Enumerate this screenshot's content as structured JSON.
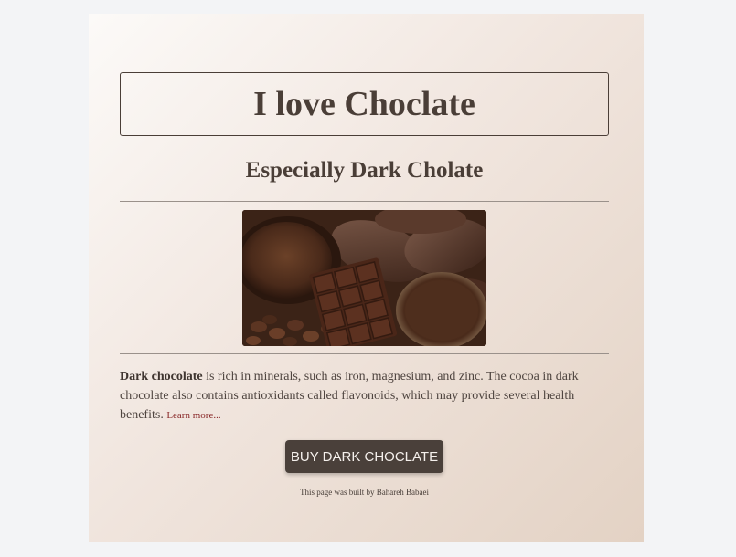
{
  "header": {
    "title": "I love Choclate",
    "subtitle": "Especially Dark Cholate"
  },
  "hero_image": {
    "alt": "dark chocolate bar with cocoa beans and cocoa powder"
  },
  "content": {
    "bold_lead": "Dark chocolate",
    "text": " is rich in minerals, such as iron, magnesium, and zinc. The cocoa in dark chocolate also contains antioxidants called flavonoids, which may provide several health benefits. ",
    "link_label": "Learn more..."
  },
  "cta": {
    "label": "BUY DARK CHOCLATE"
  },
  "footer": {
    "credit": "This page was built by Bahareh Babaei"
  },
  "colors": {
    "text": "#4a3e37",
    "button_bg": "#4a403a",
    "link": "#8a2a2a"
  }
}
